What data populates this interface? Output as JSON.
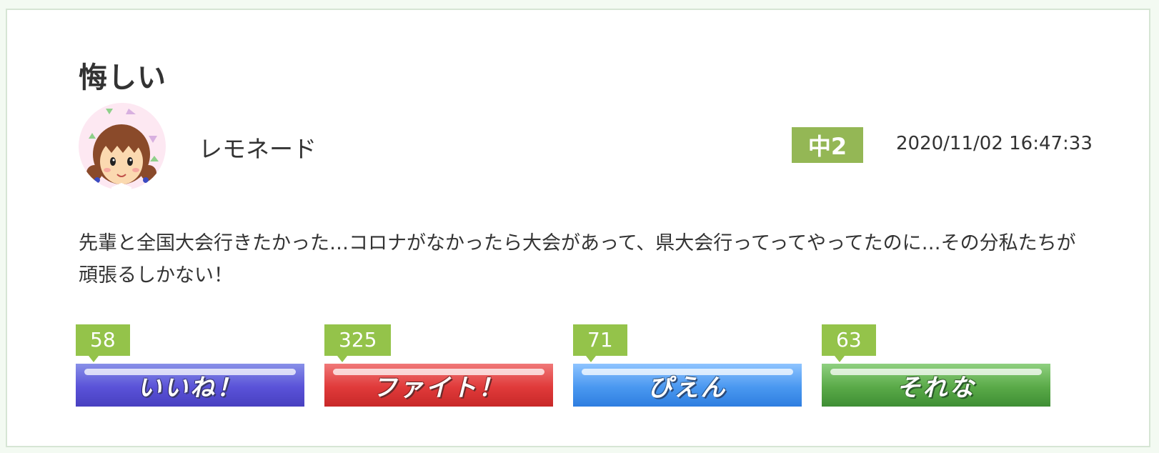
{
  "post": {
    "title": "悔しい",
    "username": "レモネード",
    "grade": "中2",
    "timestamp": "2020/11/02 16:47:33",
    "body": "先輩と全国大会行きたかった…コロナがなかったら大会があって、県大会行ってってやってたのに…その分私たちが頑張るしかない！"
  },
  "reactions": [
    {
      "label": "いいね！",
      "count": "58",
      "color": "#5a52d8"
    },
    {
      "label": "ファイト！",
      "count": "325",
      "color": "#e03a3a"
    },
    {
      "label": "ぴえん",
      "count": "71",
      "color": "#4a98f0"
    },
    {
      "label": "それな",
      "count": "63",
      "color": "#5aaa48"
    }
  ],
  "colors": {
    "badge": "#94b755",
    "count_badge": "#94c34a",
    "card_border": "#d6e5d4"
  },
  "icons": {
    "avatar": "girl-avatar-icon"
  }
}
